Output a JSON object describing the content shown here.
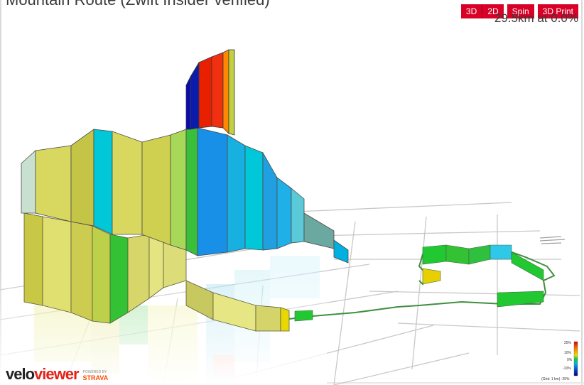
{
  "header": {
    "title": "Mountain Route (Zwift Insider verified)",
    "distance_readout": "29.5km at 0.0%"
  },
  "toolbar": {
    "btn_3d": "3D",
    "btn_2d": "2D",
    "btn_spin": "Spin",
    "btn_3d_print": "3D Print"
  },
  "legend": {
    "labels": [
      "25%",
      "10%",
      "0%",
      "-10%",
      "-25%"
    ],
    "colors": [
      "#d00000",
      "#ff7800",
      "#e8e000",
      "#22c832",
      "#00b0e8",
      "#0040c0",
      "#000080"
    ],
    "grid_note": "(Grid: 1 km) -25%"
  },
  "branding": {
    "logo_part1": "velo",
    "logo_part2": "viewer",
    "powered_by": "POWERED BY",
    "strava": "STRAVA"
  },
  "colors": {
    "accent": "#d80027",
    "grid": "#c8c8c8",
    "route_line": "#3f8f3f"
  }
}
